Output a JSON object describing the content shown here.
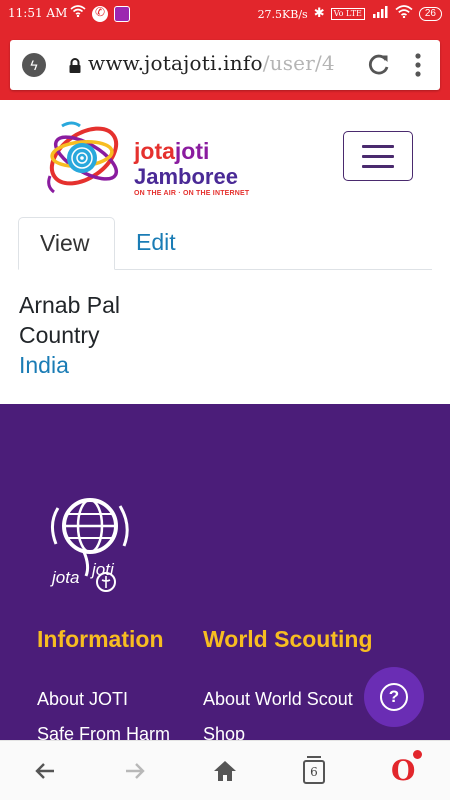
{
  "status_bar": {
    "time": "11:51 AM",
    "net_speed": "27.5KB/s",
    "volte": "Vo LTE",
    "signal": "4G",
    "battery": "26"
  },
  "address_bar": {
    "domain": "www.jotajoti.info",
    "path": "/user/4"
  },
  "site_header": {
    "logo_line_1_jota": "jota",
    "logo_line_1_joti": "joti",
    "logo_line_2": "Jamboree",
    "logo_line_3": "ON THE AIR · ON THE INTERNET"
  },
  "tabs": {
    "view_label": "View",
    "edit_label": "Edit"
  },
  "profile": {
    "name": "Arnab Pal",
    "country_label": "Country",
    "country_value": "India"
  },
  "footer": {
    "logo_text_left": "jota",
    "logo_text_right": "joti",
    "information_heading": "Information",
    "world_scouting_heading": "World Scouting",
    "information_links": [
      "About JOTI",
      "Safe From Harm"
    ],
    "world_scouting_links": [
      "About World Scout",
      "Shop"
    ]
  },
  "help_button": {
    "glyph": "?"
  },
  "bottom_nav": {
    "tab_count": "6"
  },
  "colors": {
    "browser_red": "#e2262c",
    "footer_purple": "#4b1d79",
    "heading_yellow": "#f7bd21",
    "link_blue": "#1a7cb5"
  }
}
